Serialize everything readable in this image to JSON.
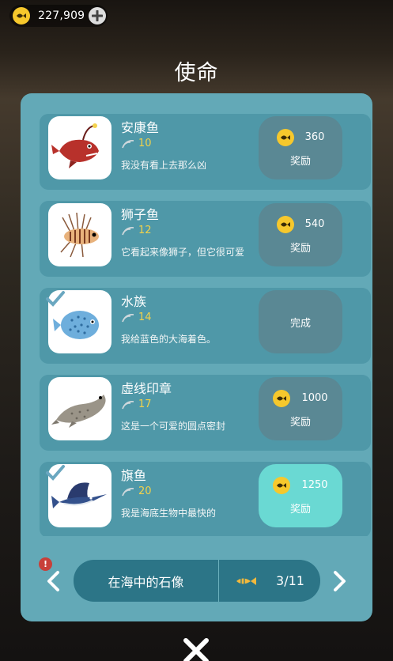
{
  "currency": {
    "amount": "227,909",
    "coin_icon": "fish-coin-icon",
    "add_icon": "plus-icon"
  },
  "title": "使命",
  "missions": [
    {
      "name": "安康鱼",
      "level": "10",
      "description": "我没有看上去那么凶",
      "reward": "360",
      "reward_label": "奖励",
      "status": "reward",
      "completed": false,
      "fish_icon": "anglerfish"
    },
    {
      "name": "狮子鱼",
      "level": "12",
      "description": "它看起来像狮子，但它很可爱",
      "reward": "540",
      "reward_label": "奖励",
      "status": "reward",
      "completed": false,
      "fish_icon": "lionfish"
    },
    {
      "name": "水族",
      "level": "14",
      "description": "我给蓝色的大海着色。",
      "status_label": "完成",
      "status": "done",
      "completed": true,
      "fish_icon": "pufferfish"
    },
    {
      "name": "虚线印章",
      "level": "17",
      "description": "这是一个可爱的圆点密封",
      "reward": "1000",
      "reward_label": "奖励",
      "status": "reward",
      "completed": false,
      "fish_icon": "seal"
    },
    {
      "name": "旗鱼",
      "level": "20",
      "description": "我是海底生物中最快的",
      "reward": "1250",
      "reward_label": "奖励",
      "status": "claimable",
      "completed": true,
      "fish_icon": "sailfish"
    }
  ],
  "footer": {
    "location": "在海中的石像",
    "progress": "3/11",
    "alert": "!"
  },
  "colors": {
    "panel": "#63a9b7",
    "card": "#4f98a8",
    "reward_button": "#5a8894",
    "reward_active": "#6ad9d3",
    "level_text": "#f2d24a",
    "coin": "#f6c82c"
  }
}
